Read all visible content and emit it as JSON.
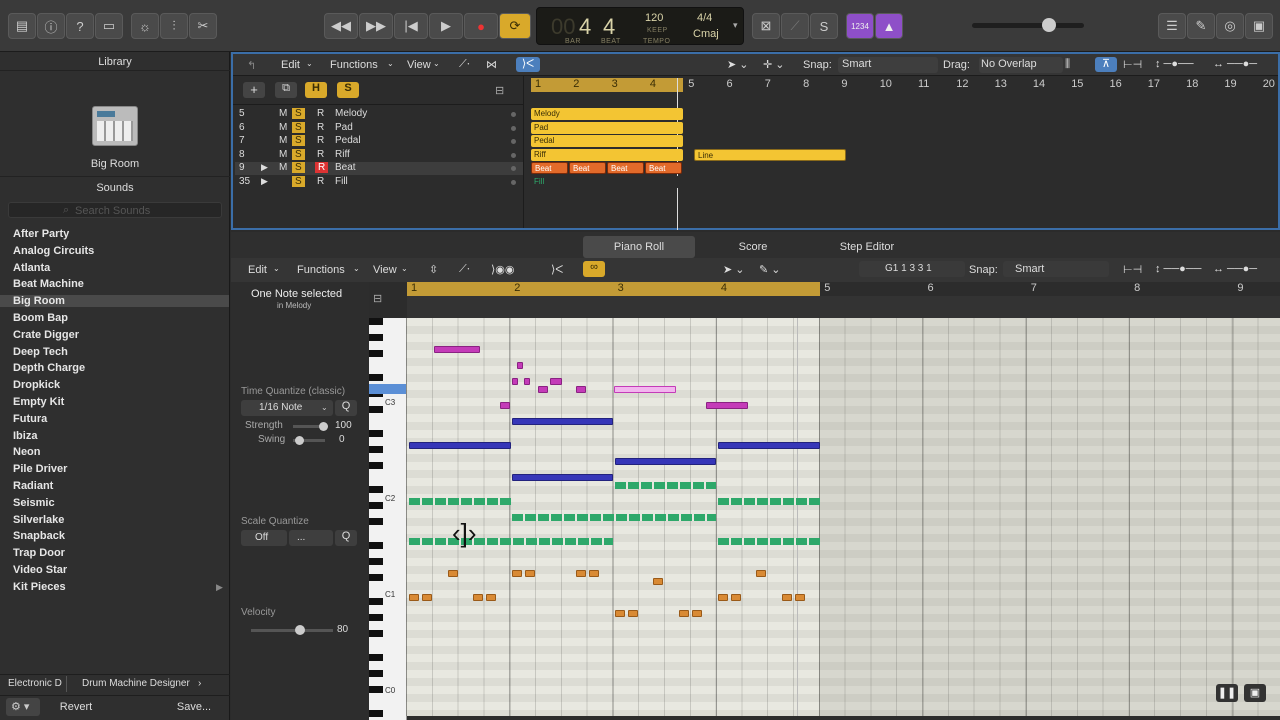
{
  "control_bar": {
    "lcd": {
      "bar": "4",
      "beat": "4",
      "bar_label": "BAR",
      "beat_label": "BEAT",
      "tempo": "120",
      "tempo_mode": "KEEP",
      "tempo_label": "TEMPO",
      "signature": "4/4",
      "key": "Cmaj"
    },
    "count_in": "1234"
  },
  "library": {
    "title": "Library",
    "patch_name": "Big Room",
    "sounds_header": "Sounds",
    "search_placeholder": "Search Sounds",
    "items": [
      "After Party",
      "Analog Circuits",
      "Atlanta",
      "Beat Machine",
      "Big Room",
      "Boom Bap",
      "Crate Digger",
      "Deep Tech",
      "Depth Charge",
      "Dropkick",
      "Empty Kit",
      "Futura",
      "Ibiza",
      "Neon",
      "Pile Driver",
      "Radiant",
      "Seismic",
      "Silverlake",
      "Snapback",
      "Trap Door",
      "Video Star",
      "Kit Pieces"
    ],
    "selected": "Big Room",
    "breadcrumb_left": "Electronic D",
    "breadcrumb_right": "Drum Machine Designer",
    "revert": "Revert",
    "save": "Save..."
  },
  "tracks": {
    "menu": {
      "edit": "Edit",
      "functions": "Functions",
      "view": "View",
      "snap_label": "Snap:",
      "snap_value": "Smart",
      "drag_label": "Drag:",
      "drag_value": "No Overlap"
    },
    "header_buttons": {
      "h": "H",
      "s": "S"
    },
    "ruler": [
      "1",
      "2",
      "3",
      "4",
      "5",
      "6",
      "7",
      "8",
      "9",
      "10",
      "11",
      "12",
      "13",
      "14",
      "15",
      "16",
      "17",
      "18",
      "19",
      "20"
    ],
    "rows": [
      {
        "num": "5",
        "m": "M",
        "s": "S",
        "r": "R",
        "name": "Melody"
      },
      {
        "num": "6",
        "m": "M",
        "s": "S",
        "r": "R",
        "name": "Pad"
      },
      {
        "num": "7",
        "m": "M",
        "s": "S",
        "r": "R",
        "name": "Pedal"
      },
      {
        "num": "8",
        "m": "M",
        "s": "S",
        "r": "R",
        "name": "Riff"
      },
      {
        "num": "9",
        "m": "M",
        "s": "S",
        "r": "R",
        "name": "Beat"
      },
      {
        "num": "35",
        "m": "",
        "s": "S",
        "r": "R",
        "name": "Fill"
      }
    ],
    "regions": {
      "melody": "Melody",
      "pad": "Pad",
      "pedal": "Pedal",
      "riff": "Riff",
      "beat": "Beat",
      "fill": "Fill",
      "line": "Line"
    }
  },
  "editor": {
    "tabs": {
      "piano_roll": "Piano Roll",
      "score": "Score",
      "step_editor": "Step Editor"
    },
    "menu": {
      "edit": "Edit",
      "functions": "Functions",
      "view": "View",
      "position": "G1  1 3 3 1",
      "snap_label": "Snap:",
      "snap_value": "Smart"
    },
    "status": "One Note selected",
    "status_sub": "in Melody",
    "time_quantize_label": "Time Quantize (classic)",
    "time_quantize_value": "1/16 Note",
    "q": "Q",
    "strength_label": "Strength",
    "strength_value": "100",
    "swing_label": "Swing",
    "swing_value": "0",
    "scale_quantize_label": "Scale Quantize",
    "scale_off": "Off",
    "scale_dots": "...",
    "velocity_label": "Velocity",
    "velocity_value": "80",
    "ruler": [
      "1",
      "2",
      "3",
      "4",
      "5",
      "6",
      "7",
      "8",
      "9"
    ],
    "key_labels": [
      "C3",
      "C2",
      "C1",
      "C0"
    ]
  }
}
